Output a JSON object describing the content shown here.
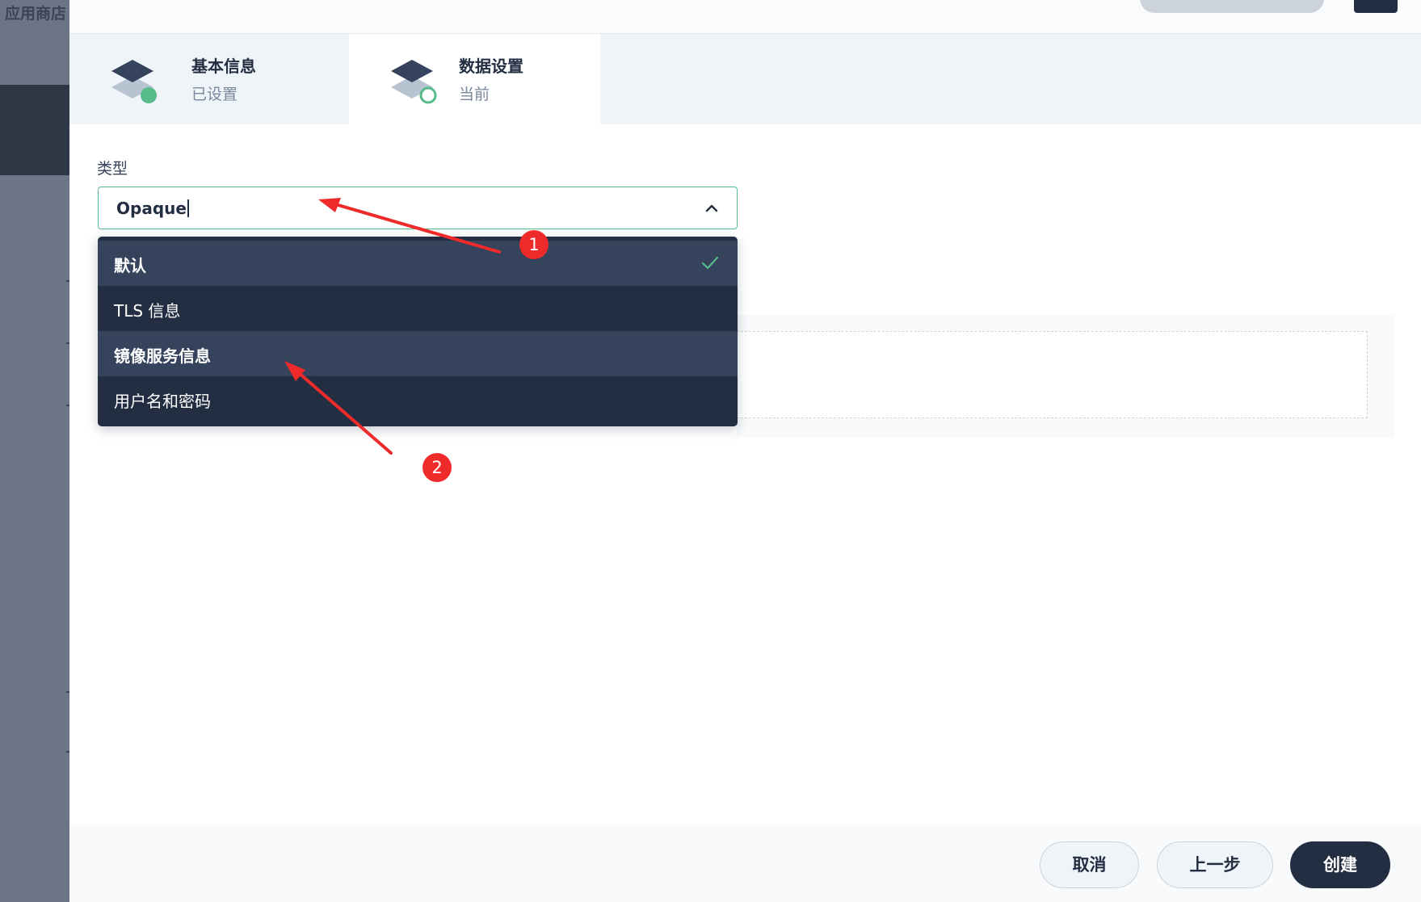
{
  "background": {
    "app_title": "应用商店"
  },
  "steps": [
    {
      "title": "基本信息",
      "subtitle": "已设置",
      "state": "done"
    },
    {
      "title": "数据设置",
      "subtitle": "当前",
      "state": "current"
    }
  ],
  "form": {
    "type_label": "类型",
    "type_value": "Opaque",
    "options": [
      {
        "label": "默认",
        "selected": true,
        "highlighted": true
      },
      {
        "label": "TLS 信息",
        "selected": false,
        "highlighted": false
      },
      {
        "label": "镜像服务信息",
        "selected": false,
        "highlighted": true
      },
      {
        "label": "用户名和密码",
        "selected": false,
        "highlighted": false
      }
    ]
  },
  "footer": {
    "cancel_label": "取消",
    "prev_label": "上一步",
    "create_label": "创建"
  },
  "annotations": {
    "badge1": "1",
    "badge2": "2"
  },
  "colors": {
    "accent_green": "#55bc8a",
    "dark": "#242e42",
    "dropdown_highlight": "#36435c",
    "annotation_red": "#ee2a2a"
  },
  "icons": [
    "layers-icon",
    "status-done-dot-icon",
    "status-current-ring-icon",
    "chevron-up-icon",
    "check-icon"
  ]
}
